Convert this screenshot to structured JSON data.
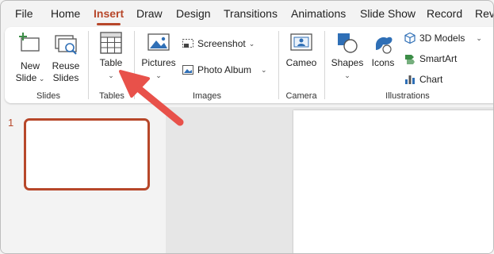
{
  "tabs": [
    {
      "label": "File"
    },
    {
      "label": "Home"
    },
    {
      "label": "Insert",
      "active": true
    },
    {
      "label": "Draw"
    },
    {
      "label": "Design"
    },
    {
      "label": "Transitions"
    },
    {
      "label": "Animations"
    },
    {
      "label": "Slide Show"
    },
    {
      "label": "Record"
    },
    {
      "label": "Revi"
    }
  ],
  "ribbon": {
    "slides_group": {
      "label": "Slides",
      "new_slide": {
        "line1": "New",
        "line2": "Slide"
      },
      "reuse_slides": {
        "line1": "Reuse",
        "line2": "Slides"
      }
    },
    "tables_group": {
      "label": "Tables",
      "table": {
        "label": "Table"
      }
    },
    "images_group": {
      "label": "Images",
      "pictures": {
        "label": "Pictures"
      },
      "screenshot": {
        "label": "Screenshot"
      },
      "photo_album": {
        "label": "Photo Album"
      }
    },
    "camera_group": {
      "label": "Camera",
      "cameo": {
        "label": "Cameo"
      }
    },
    "illustrations_group": {
      "label": "Illustrations",
      "shapes": {
        "label": "Shapes"
      },
      "icons": {
        "label": "Icons"
      },
      "models_3d": {
        "label": "3D Models"
      },
      "smartart": {
        "label": "SmartArt"
      },
      "chart": {
        "label": "Chart"
      }
    }
  },
  "slides_pane": {
    "slide_number": "1"
  },
  "colors": {
    "accent": "#b7472a",
    "annotation_arrow": "#e8514a"
  }
}
